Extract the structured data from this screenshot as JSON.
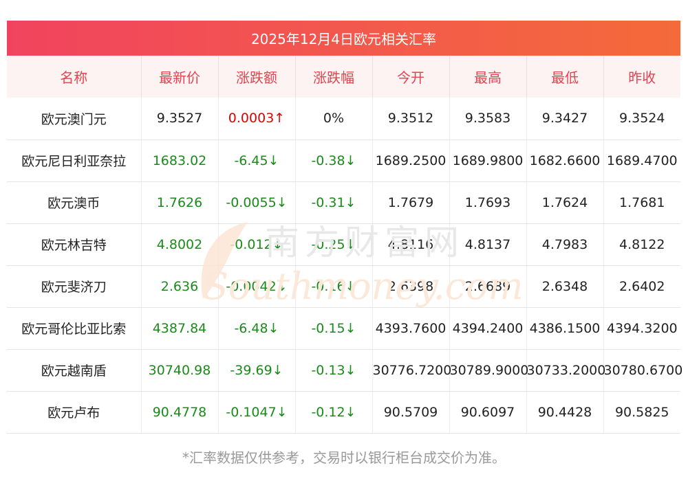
{
  "title": "2025年12月4日欧元相关汇率",
  "headers": [
    "名称",
    "最新价",
    "涨跌额",
    "涨跌幅",
    "今开",
    "最高",
    "最低",
    "昨收"
  ],
  "rows": [
    {
      "name": "欧元澳门元",
      "latest": "9.3527",
      "change": "0.0003↑",
      "pct": "0%",
      "open": "9.3512",
      "high": "9.3583",
      "low": "9.3427",
      "prev": "9.3524",
      "trend": "up"
    },
    {
      "name": "欧元尼日利亚奈拉",
      "latest": "1683.02",
      "change": "-6.45↓",
      "pct": "-0.38↓",
      "open": "1689.2500",
      "high": "1689.9800",
      "low": "1682.6600",
      "prev": "1689.4700",
      "trend": "down"
    },
    {
      "name": "欧元澳币",
      "latest": "1.7626",
      "change": "-0.0055↓",
      "pct": "-0.31↓",
      "open": "1.7679",
      "high": "1.7693",
      "low": "1.7624",
      "prev": "1.7681",
      "trend": "down"
    },
    {
      "name": "欧元林吉特",
      "latest": "4.8002",
      "change": "-0.012↓",
      "pct": "-0.25↓",
      "open": "4.8116",
      "high": "4.8137",
      "low": "4.7983",
      "prev": "4.8122",
      "trend": "down"
    },
    {
      "name": "欧元斐济刀",
      "latest": "2.636",
      "change": "-0.0042↓",
      "pct": "-0.16↓",
      "open": "2.6398",
      "high": "2.6689",
      "low": "2.6348",
      "prev": "2.6402",
      "trend": "down"
    },
    {
      "name": "欧元哥伦比亚比索",
      "latest": "4387.84",
      "change": "-6.48↓",
      "pct": "-0.15↓",
      "open": "4393.7600",
      "high": "4394.2400",
      "low": "4386.1500",
      "prev": "4394.3200",
      "trend": "down"
    },
    {
      "name": "欧元越南盾",
      "latest": "30740.98",
      "change": "-39.69↓",
      "pct": "-0.13↓",
      "open": "30776.7200",
      "high": "30789.9000",
      "low": "30733.2000",
      "prev": "30780.6700",
      "trend": "down"
    },
    {
      "name": "欧元卢布",
      "latest": "90.4778",
      "change": "-0.1047↓",
      "pct": "-0.12↓",
      "open": "90.5709",
      "high": "90.6097",
      "low": "90.4428",
      "prev": "90.5825",
      "trend": "down"
    }
  ],
  "watermark": {
    "cn": "南方财富网",
    "en": "Southmoney.com"
  },
  "footer": "*汇率数据仅供参考，交易时以银行柜台成交价为准。",
  "colors": {
    "header_text": "#e5424f",
    "up": "#e10000",
    "down": "#1a8a1a",
    "title_bg_start": "#f1435e",
    "title_bg_end": "#f46a3a"
  }
}
